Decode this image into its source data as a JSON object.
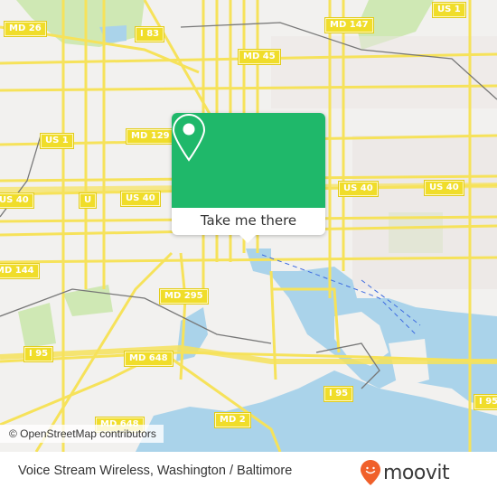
{
  "map": {
    "shields": [
      {
        "label": "MD 26"
      },
      {
        "label": "I 83"
      },
      {
        "label": "MD 147"
      },
      {
        "label": "US 1"
      },
      {
        "label": "MD 45"
      },
      {
        "label": "MD 129"
      },
      {
        "label": "US 1"
      },
      {
        "label": "US 40"
      },
      {
        "label": "U"
      },
      {
        "label": "US 40"
      },
      {
        "label": "US 40"
      },
      {
        "label": "US 40"
      },
      {
        "label": "MD 144"
      },
      {
        "label": "MD 295"
      },
      {
        "label": "I 95"
      },
      {
        "label": "MD 648"
      },
      {
        "label": "MD 648"
      },
      {
        "label": "I 95"
      },
      {
        "label": "MD 2"
      },
      {
        "label": "I 95"
      }
    ],
    "attribution": "© OpenStreetMap contributors",
    "colors": {
      "land": "#f2f1ef",
      "water": "#aad3ea",
      "park": "#cfe8b4",
      "road": "#f6e25a",
      "rail": "#777777"
    }
  },
  "popup": {
    "icon": "map-pin-icon",
    "button_label": "Take me there",
    "accent": "#1fb86a"
  },
  "footer": {
    "title": "Voice Stream Wireless, Washington / Baltimore",
    "brand": "moovit",
    "brand_icon": "moovit-pin-icon",
    "brand_color": "#f0602a"
  }
}
